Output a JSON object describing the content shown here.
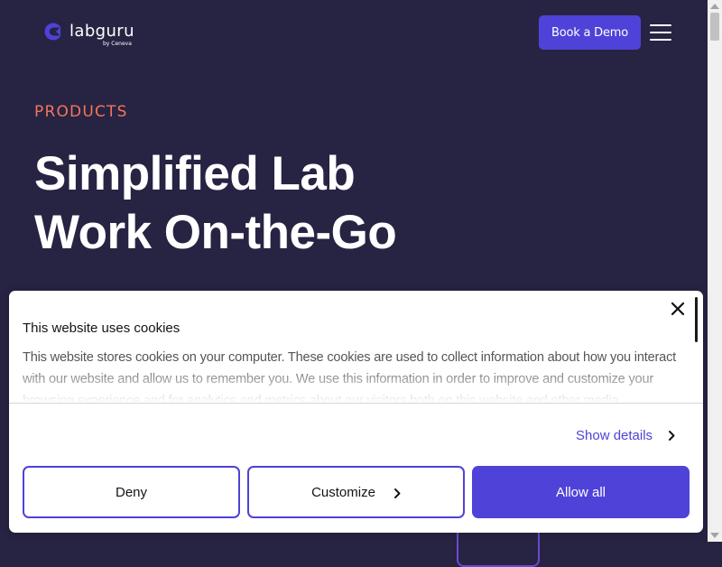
{
  "header": {
    "logo": {
      "name": "labguru",
      "tagline": "by Ceneva"
    },
    "demo_button": "Book a Demo",
    "menu_icon": "hamburger-menu-icon"
  },
  "hero": {
    "eyebrow": "PRODUCTS",
    "title": "Simplified Lab Work On-the-Go"
  },
  "cookie_banner": {
    "title": "This website uses cookies",
    "text": "This website stores cookies on your computer. These cookies are used to collect information about how you interact with our website and allow us to remember you. We use this information in order to improve and customize your browsing experience and for analytics and metrics about our visitors both on this website and other media.",
    "show_details": "Show details",
    "deny": "Deny",
    "customize": "Customize",
    "allow_all": "Allow all",
    "close_icon": "close-icon"
  },
  "colors": {
    "background": "#272343",
    "accent": "#4f42d8",
    "eyebrow": "#f2755a"
  }
}
